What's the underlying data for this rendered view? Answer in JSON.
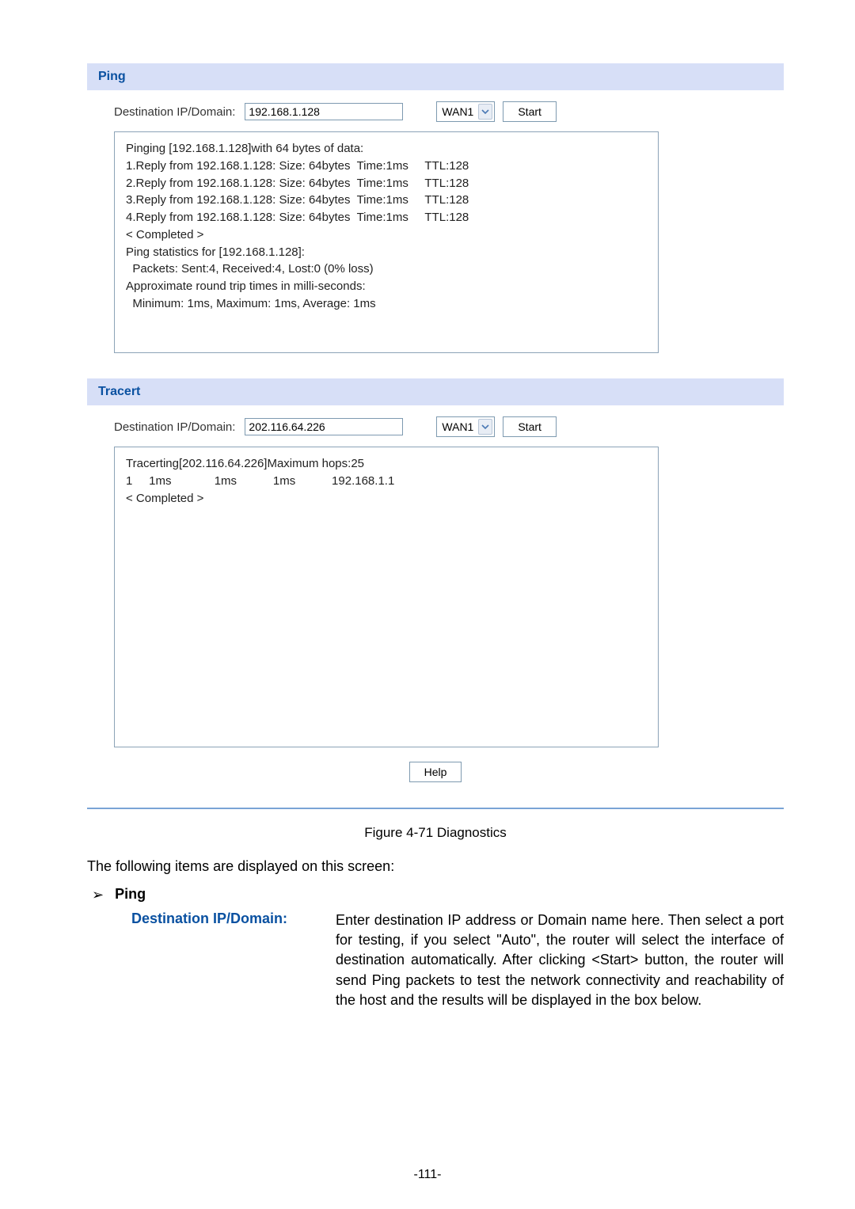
{
  "ping": {
    "header": "Ping",
    "dest_label": "Destination IP/Domain:",
    "dest_value": "192.168.1.128",
    "wan_selected": "WAN1",
    "start_label": "Start",
    "results": "Pinging [192.168.1.128]with 64 bytes of data:\n1.Reply from 192.168.1.128: Size: 64bytes  Time:1ms     TTL:128\n2.Reply from 192.168.1.128: Size: 64bytes  Time:1ms     TTL:128\n3.Reply from 192.168.1.128: Size: 64bytes  Time:1ms     TTL:128\n4.Reply from 192.168.1.128: Size: 64bytes  Time:1ms     TTL:128\n< Completed >\nPing statistics for [192.168.1.128]:\n  Packets: Sent:4, Received:4, Lost:0 (0% loss)\nApproximate round trip times in milli-seconds:\n  Minimum: 1ms, Maximum: 1ms, Average: 1ms"
  },
  "tracert": {
    "header": "Tracert",
    "dest_label": "Destination IP/Domain:",
    "dest_value": "202.116.64.226",
    "wan_selected": "WAN1",
    "start_label": "Start",
    "results": "Tracerting[202.116.64.226]Maximum hops:25\n1     1ms             1ms           1ms           192.168.1.1\n< Completed >"
  },
  "help_label": "Help",
  "figure_caption": "Figure 4-71 Diagnostics",
  "intro_text": "The following items are displayed on this screen:",
  "section_ping": {
    "bullet_label": "Ping",
    "term": "Destination IP/Domain:",
    "desc": "Enter destination IP address or Domain name here. Then select a port for testing, if you select \"Auto\", the router will select the interface of destination automatically. After clicking <Start> button, the router will send Ping packets to test the network connectivity and reachability of the host and the results will be displayed in the box below."
  },
  "page_number": "-111-"
}
